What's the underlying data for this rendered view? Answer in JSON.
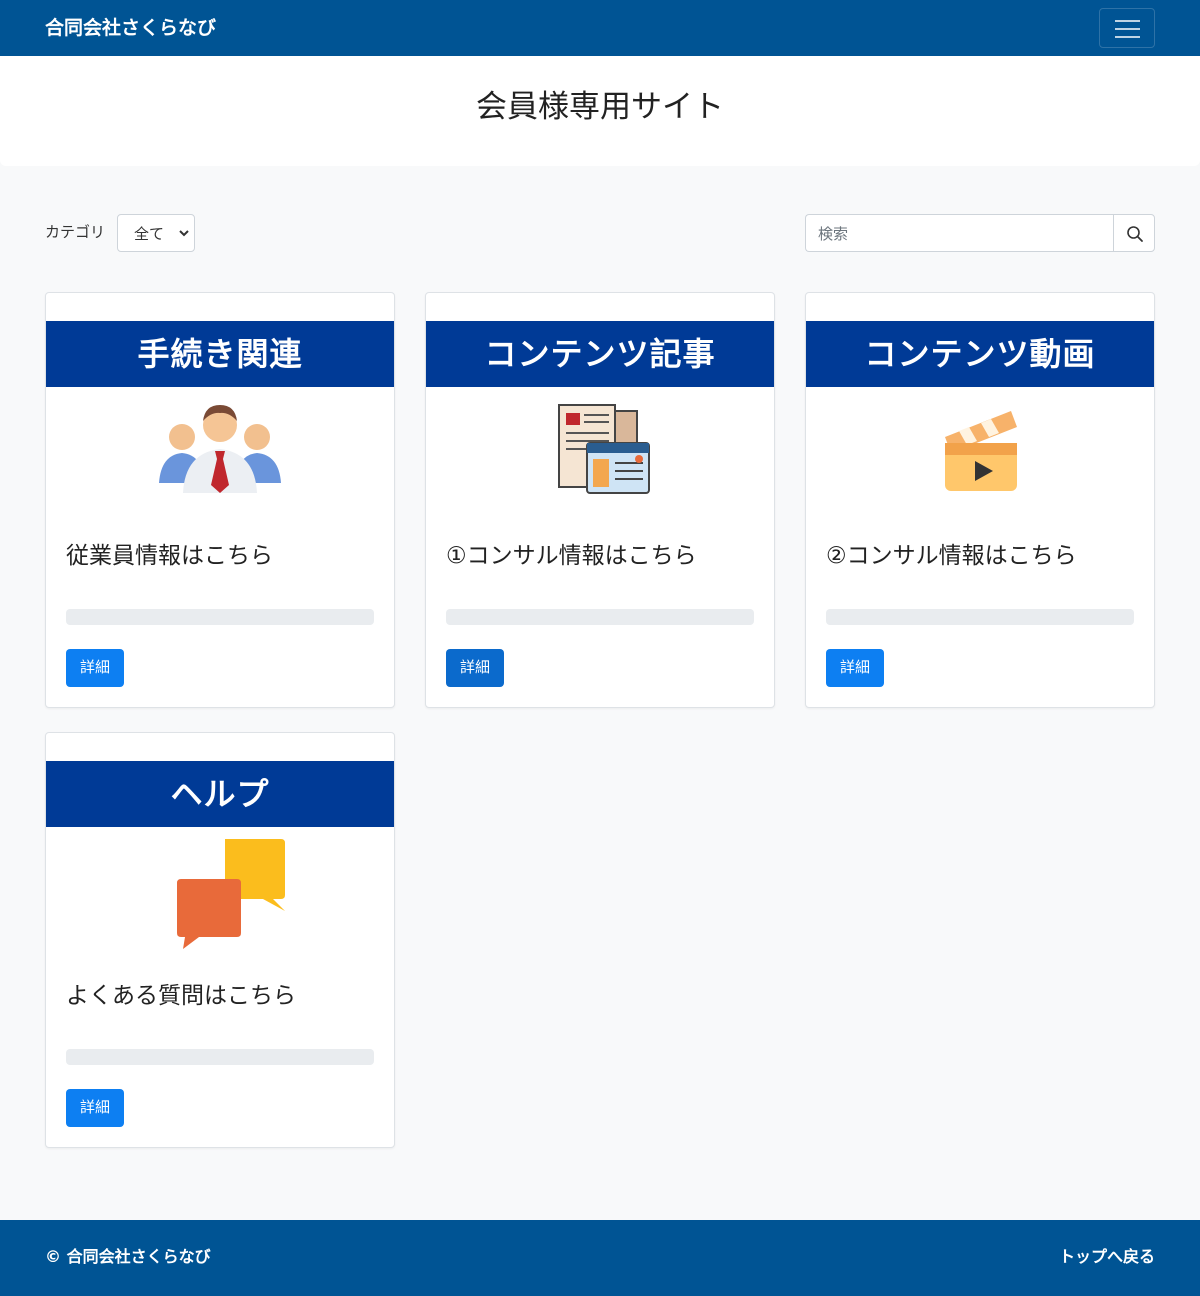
{
  "navbar": {
    "brand": "合同会社さくらなび",
    "colors": {
      "background": "#005494"
    }
  },
  "hero": {
    "title": "会員様専用サイト"
  },
  "filter": {
    "category_label": "カテゴリ",
    "category_selected": "全て",
    "search_placeholder": "検索"
  },
  "cards": [
    {
      "header": "手続き関連",
      "text": "従業員情報はこちら",
      "button": "詳細",
      "icon": "employees-icon"
    },
    {
      "header": "コンテンツ記事",
      "text": "①コンサル情報はこちら",
      "button": "詳細",
      "icon": "documents-icon"
    },
    {
      "header": "コンテンツ動画",
      "text": "②コンサル情報はこちら",
      "button": "詳細",
      "icon": "clapperboard-icon"
    },
    {
      "header": "ヘルプ",
      "text": "よくある質問はこちら",
      "button": "詳細",
      "icon": "qa-icon"
    }
  ],
  "footer": {
    "copyright": "© 合同会社さくらなび",
    "back_to_top": "トップへ戻る"
  },
  "colors": {
    "card_header": "#003a96",
    "button": "#0d7ff2"
  }
}
